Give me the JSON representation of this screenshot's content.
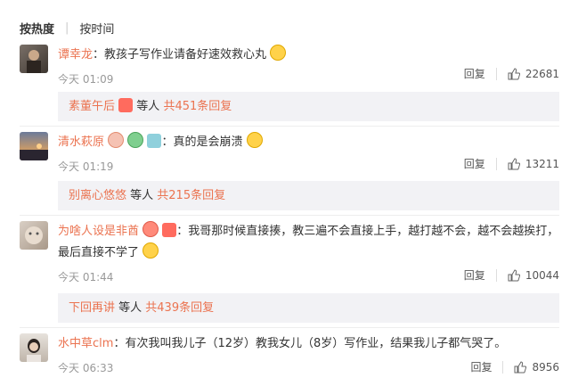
{
  "sort": {
    "active": "按热度",
    "inactive": "按时间"
  },
  "colors": {
    "username": "#eb7350",
    "reply_bg": "#f2f2f5"
  },
  "comments": [
    {
      "user": "谭幸龙",
      "text": "：教孩子写作业请备好速效救心丸",
      "time": "今天 01:09",
      "reply_label": "回复",
      "likes": "22681",
      "reply_summary": {
        "name": "素董午后",
        "mid": " 等人 ",
        "count": "共451条回复"
      }
    },
    {
      "user": "清水萩原",
      "text": "：真的是会崩溃",
      "time": "今天 01:19",
      "reply_label": "回复",
      "likes": "13211",
      "reply_summary": {
        "name": "别离心悠悠",
        "mid": " 等人 ",
        "count": "共215条回复"
      }
    },
    {
      "user": "为啥人设是非酋",
      "text": "：我哥那时候直接揍，教三遍不会直接上手，越打越不会，越不会越挨打，",
      "text2": "最后直接不学了",
      "time": "今天 01:44",
      "reply_label": "回复",
      "likes": "10044",
      "reply_summary": {
        "name": "下回再讲",
        "mid": " 等人 ",
        "count": "共439条回复"
      }
    },
    {
      "user": "水中草clm",
      "text": "：有次我叫我儿子（12岁）教我女儿（8岁）写作业，结果我儿子都气哭了。",
      "time": "今天 06:33",
      "reply_label": "回复",
      "likes": "8956"
    }
  ]
}
